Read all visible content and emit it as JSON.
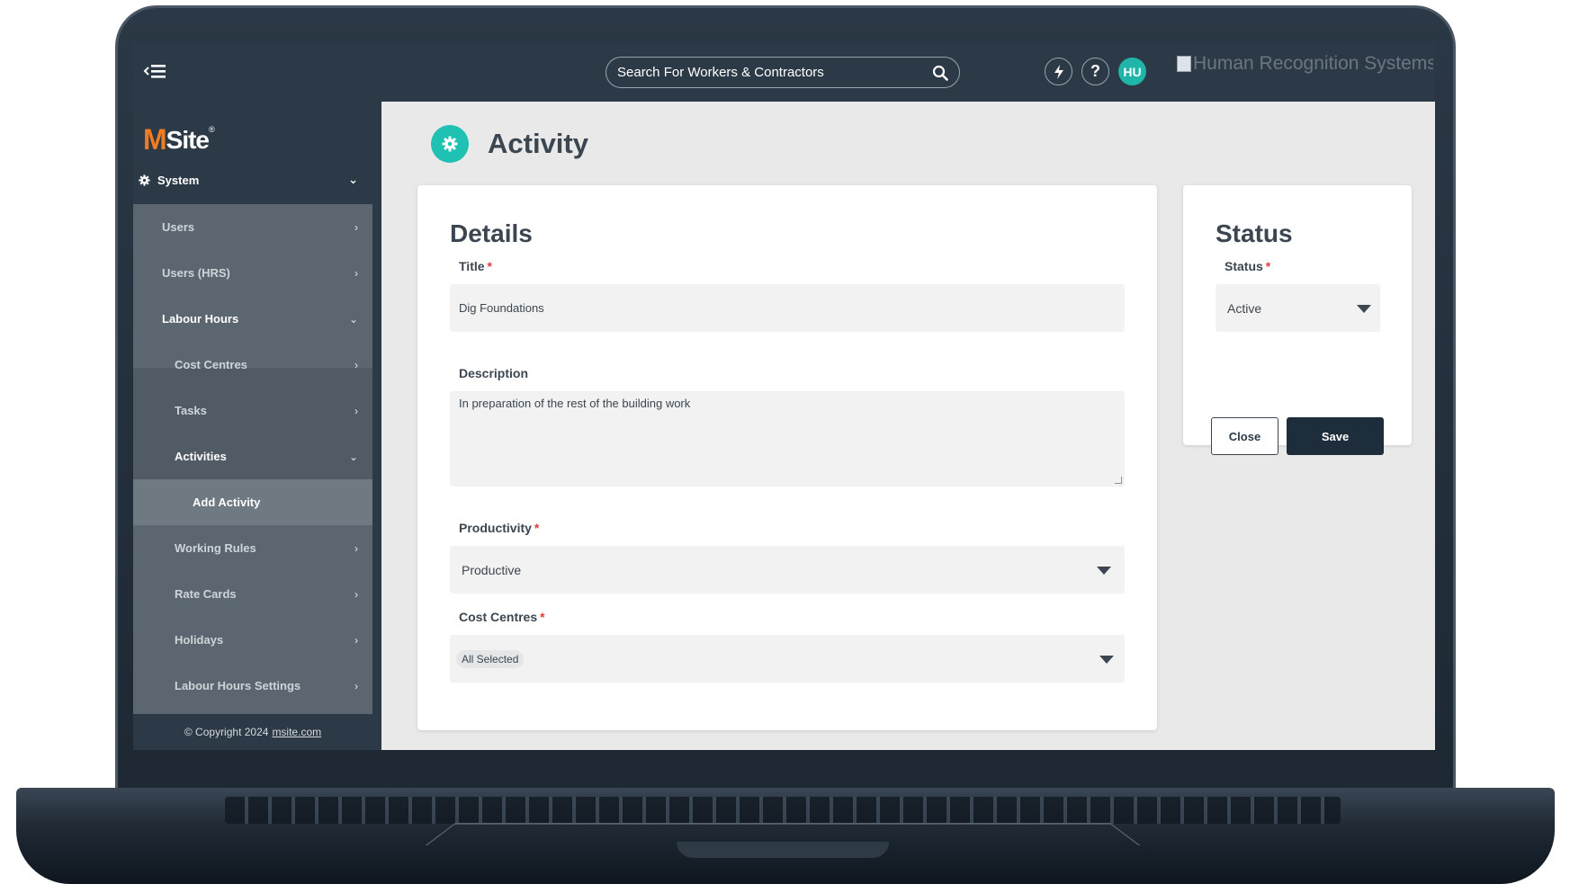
{
  "header": {
    "search_placeholder": "Search For Workers & Contractors",
    "avatar_initials": "HU",
    "help_label": "?",
    "brand_image_alt": "Human Recognition Systems"
  },
  "logo": {
    "m": "M",
    "rest": "Site",
    "reg": "®"
  },
  "sidebar": {
    "system_label": "System",
    "items": [
      {
        "label": "Users"
      },
      {
        "label": "Users (HRS)"
      },
      {
        "label": "Labour Hours"
      },
      {
        "label": "Cost Centres"
      },
      {
        "label": "Tasks"
      },
      {
        "label": "Activities"
      },
      {
        "label": "Add Activity"
      },
      {
        "label": "Working Rules"
      },
      {
        "label": "Rate Cards"
      },
      {
        "label": "Holidays"
      },
      {
        "label": "Labour Hours Settings"
      }
    ],
    "copyright_text": "© Copyright 2024",
    "copyright_link": "msite.com"
  },
  "page": {
    "title": "Activity"
  },
  "details": {
    "heading": "Details",
    "title_label": "Title",
    "title_value": "Dig Foundations",
    "description_label": "Description",
    "description_value": "In preparation of the rest of the building work",
    "productivity_label": "Productivity",
    "productivity_value": "Productive",
    "cost_centres_label": "Cost Centres",
    "cost_centres_value": "All Selected",
    "required_mark": "*"
  },
  "status": {
    "heading": "Status",
    "status_label": "Status",
    "status_value": "Active",
    "close_label": "Close",
    "save_label": "Save"
  },
  "colors": {
    "topbar": "#2c3a47",
    "accent_teal": "#1fc2b2",
    "logo_orange": "#f07d21",
    "save_button": "#1e2d3b",
    "required": "#e23b3b"
  }
}
